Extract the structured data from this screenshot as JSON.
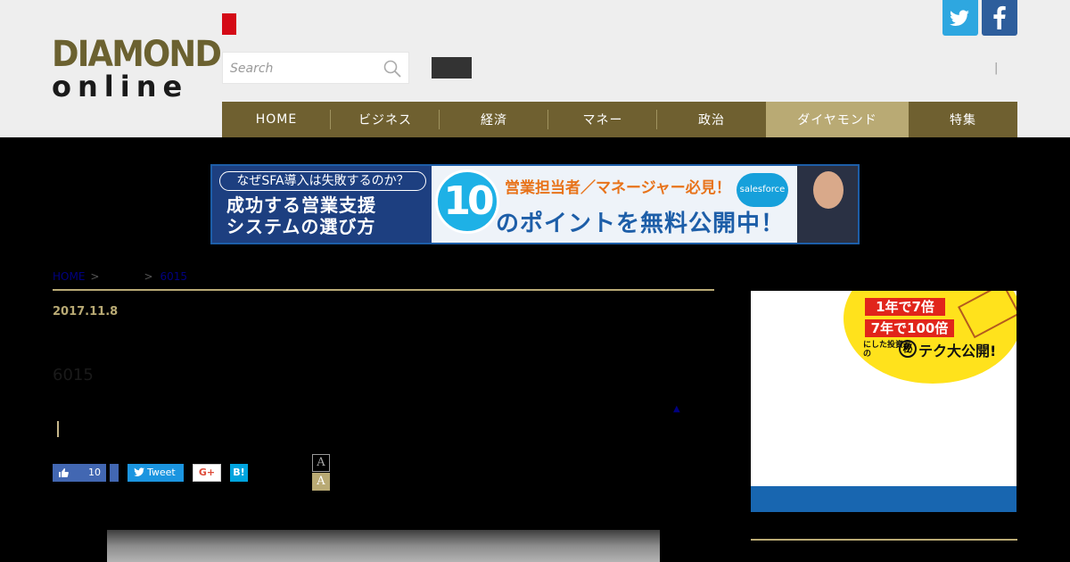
{
  "header": {
    "logo_top": "DIAMOND",
    "logo_bottom": "online",
    "search_placeholder": "Search",
    "pipe": "|"
  },
  "nav": {
    "items": [
      {
        "label": "HOME"
      },
      {
        "label": "ビジネス"
      },
      {
        "label": "経済"
      },
      {
        "label": "マネー"
      },
      {
        "label": "政治"
      },
      {
        "label": "ダイヤモンド"
      },
      {
        "label": "特集"
      }
    ],
    "active_index": 5
  },
  "banner": {
    "pill": "なぜSFA導入は失敗するのか？",
    "headline1": "成功する営業支援",
    "headline2": "システムの選び方",
    "number": "10",
    "subhead": "営業担当者／マネージャー必見！",
    "main": "のポイントを無料公開中！",
    "brand": "salesforce"
  },
  "breadcrumb": {
    "home": "HOME",
    "sep": ">",
    "current": "6015"
  },
  "article": {
    "date": "2017.11.8",
    "title": "6015",
    "caret": "▲"
  },
  "share": {
    "like_count": "10",
    "tweet_label": "Tweet",
    "gplus_label": "G+",
    "hatena_label": "B!",
    "font_small": "A",
    "font_large": "A"
  },
  "side_ad": {
    "line1": "1年で7倍",
    "line2": "7年で100倍",
    "line3": "にした投資家の",
    "maru": "秘",
    "line4": "テク大公開!"
  },
  "colors": {
    "gold": "#b9aa74",
    "nav_bg": "#6f6030",
    "twitter": "#2ea7e0",
    "facebook": "#2e5e9c"
  }
}
